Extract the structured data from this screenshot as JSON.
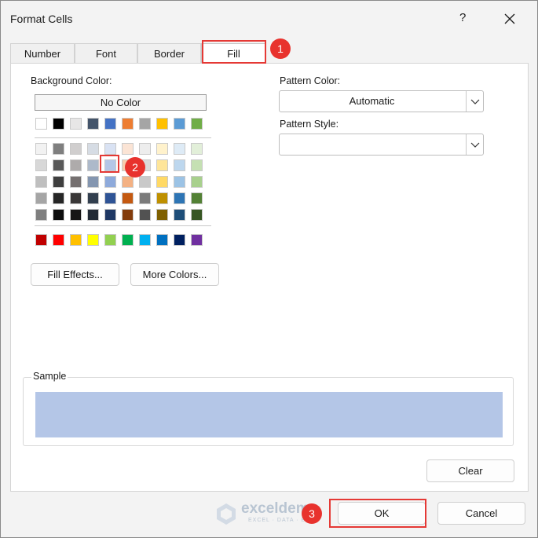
{
  "window": {
    "title": "Format Cells",
    "help_label": "?"
  },
  "tabs": [
    {
      "label": "Number"
    },
    {
      "label": "Font"
    },
    {
      "label": "Border"
    },
    {
      "label": "Fill",
      "active": true
    }
  ],
  "fill": {
    "background_color_label": "Background Color:",
    "no_color_label": "No Color",
    "fill_effects_label": "Fill Effects...",
    "more_colors_label": "More Colors...",
    "theme_colors": [
      "#ffffff",
      "#000000",
      "#e7e6e6",
      "#44546a",
      "#4472c4",
      "#ed7d31",
      "#a5a5a5",
      "#ffc000",
      "#5b9bd5",
      "#70ad47"
    ],
    "tint_rows": [
      [
        "#f2f2f2",
        "#7f7f7f",
        "#d0cece",
        "#d6dce4",
        "#d9e2f3",
        "#fbe4d5",
        "#ededed",
        "#fff2cc",
        "#deebf6",
        "#e2efd9"
      ],
      [
        "#d8d8d8",
        "#595959",
        "#aeabab",
        "#adb9ca",
        "#b4c6e7",
        "#f7cbac",
        "#dbdbdb",
        "#fee599",
        "#bdd7ee",
        "#c5e0b3"
      ],
      [
        "#bfbfbf",
        "#3f3f3f",
        "#757070",
        "#8496b0",
        "#8eaadb",
        "#f4b183",
        "#c9c9c9",
        "#ffd965",
        "#9cc3e5",
        "#a8d08d"
      ],
      [
        "#a5a5a5",
        "#262626",
        "#3a3838",
        "#323f4f",
        "#2f5496",
        "#c45911",
        "#7b7b7b",
        "#bf9000",
        "#2e75b5",
        "#538135"
      ],
      [
        "#7f7f7f",
        "#0c0c0c",
        "#171616",
        "#222a35",
        "#1f3864",
        "#833c0b",
        "#525252",
        "#7f6000",
        "#1e4e79",
        "#375623"
      ]
    ],
    "standard_colors": [
      "#c00000",
      "#ff0000",
      "#ffc000",
      "#ffff00",
      "#92d050",
      "#00b050",
      "#00b0f0",
      "#0070c0",
      "#002060",
      "#7030a0"
    ],
    "selected_color": "#b4c6e7"
  },
  "pattern": {
    "color_label": "Pattern Color:",
    "color_value": "Automatic",
    "style_label": "Pattern Style:",
    "style_value": ""
  },
  "sample": {
    "label": "Sample",
    "color": "#b4c6e7"
  },
  "buttons": {
    "clear": "Clear",
    "ok": "OK",
    "cancel": "Cancel"
  },
  "annotations": [
    "1",
    "2",
    "3"
  ],
  "watermark": {
    "name": "exceldemy",
    "tagline": "EXCEL · DATA · BI"
  }
}
